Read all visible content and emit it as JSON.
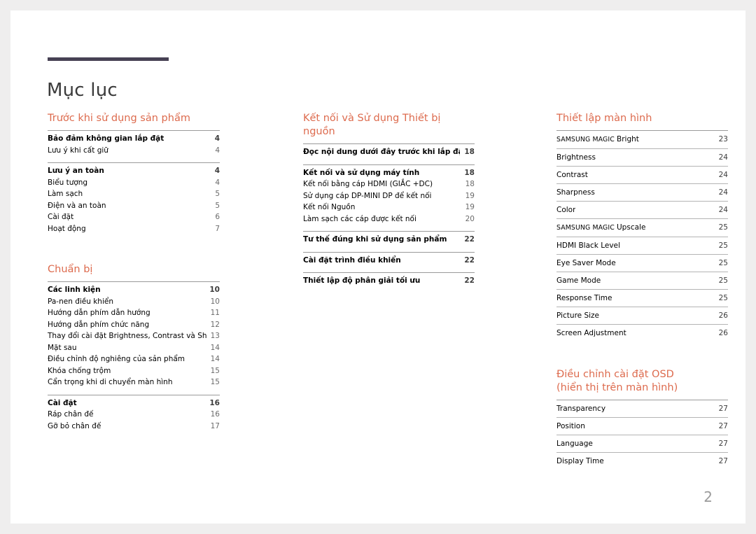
{
  "document": {
    "title": "Mục lục",
    "folio": "2",
    "accent_color": "#dd6b4e",
    "rule_color": "#474154"
  },
  "columns": [
    {
      "id": "column-1",
      "sections": [
        {
          "heading": "Trước khi sử dụng sản phẩm",
          "groups": [
            {
              "entries": [
                {
                  "title": "Bảo đảm không gian lắp đặt",
                  "page": "4",
                  "lead": true
                },
                {
                  "title": "Lưu ý khi cất giữ",
                  "page": "4",
                  "lead": false
                }
              ]
            },
            {
              "entries": [
                {
                  "title": "Lưu ý an toàn",
                  "page": "4",
                  "lead": true
                },
                {
                  "title": "Biểu tượng",
                  "page": "4",
                  "lead": false
                },
                {
                  "title": "Làm sạch",
                  "page": "5",
                  "lead": false
                },
                {
                  "title": "Điện và an toàn",
                  "page": "5",
                  "lead": false
                },
                {
                  "title": "Cài đặt",
                  "page": "6",
                  "lead": false
                },
                {
                  "title": "Hoạt động",
                  "page": "7",
                  "lead": false
                }
              ]
            }
          ]
        },
        {
          "heading": "Chuẩn bị",
          "groups": [
            {
              "entries": [
                {
                  "title": "Các linh kiện",
                  "page": "10",
                  "lead": true
                },
                {
                  "title": "Pa-nen điều khiển",
                  "page": "10",
                  "lead": false
                },
                {
                  "title": "Hướng dẫn phím dẫn hướng",
                  "page": "11",
                  "lead": false
                },
                {
                  "title": "Hướng dẫn phím chức năng",
                  "page": "12",
                  "lead": false
                },
                {
                  "title": "Thay đổi cài đặt Brightness, Contrast và Sharpness",
                  "page": "13",
                  "lead": false
                },
                {
                  "title": "Mặt sau",
                  "page": "14",
                  "lead": false
                },
                {
                  "title": "Điều chỉnh độ nghiêng của sản phẩm",
                  "page": "14",
                  "lead": false
                },
                {
                  "title": "Khóa chống trộm",
                  "page": "15",
                  "lead": false
                },
                {
                  "title": "Cẩn trọng khi di chuyển màn hình",
                  "page": "15",
                  "lead": false
                }
              ]
            },
            {
              "entries": [
                {
                  "title": "Cài đặt",
                  "page": "16",
                  "lead": true
                },
                {
                  "title": "Ráp chân đế",
                  "page": "16",
                  "lead": false
                },
                {
                  "title": "Gỡ bỏ chân đế",
                  "page": "17",
                  "lead": false
                }
              ]
            }
          ]
        }
      ]
    },
    {
      "id": "column-2",
      "sections": [
        {
          "heading": "Kết nối và Sử dụng Thiết bị nguồn",
          "groups": [
            {
              "entries": [
                {
                  "title": "Đọc nội dung dưới đây trước khi lắp đặt màn hình.",
                  "page": "18",
                  "lead": true
                }
              ]
            },
            {
              "entries": [
                {
                  "title": "Kết nối và sử dụng máy tính",
                  "page": "18",
                  "lead": true
                },
                {
                  "title": "Kết nối bằng cáp HDMI (GIẮC +DC)",
                  "page": "18",
                  "lead": false
                },
                {
                  "title": "Sử dụng cáp DP-MINI DP để kết nối",
                  "page": "19",
                  "lead": false
                },
                {
                  "title": "Kết nối Nguồn",
                  "page": "19",
                  "lead": false
                },
                {
                  "title": "Làm sạch các cáp được kết nối",
                  "page": "20",
                  "lead": false
                }
              ]
            },
            {
              "entries": [
                {
                  "title": "Tư thế đúng khi sử dụng sản phẩm",
                  "page": "22",
                  "lead": true
                }
              ]
            },
            {
              "entries": [
                {
                  "title": "Cài đặt trình điều khiển",
                  "page": "22",
                  "lead": true
                }
              ]
            },
            {
              "entries": [
                {
                  "title": "Thiết lập độ phân giải tối ưu",
                  "page": "22",
                  "lead": true
                }
              ]
            }
          ]
        }
      ]
    },
    {
      "id": "column-3",
      "sections": [
        {
          "heading": "Thiết lập màn hình",
          "ruled": true,
          "groups": [
            {
              "entries": [
                {
                  "title": "SAMSUNG MAGIC Bright",
                  "smallcaps": "SAMSUNG MAGIC",
                  "rest": "Bright",
                  "page": "23",
                  "lead": false
                },
                {
                  "title": "Brightness",
                  "page": "24",
                  "lead": false
                },
                {
                  "title": "Contrast",
                  "page": "24",
                  "lead": false
                },
                {
                  "title": "Sharpness",
                  "page": "24",
                  "lead": false
                },
                {
                  "title": "Color",
                  "page": "24",
                  "lead": false
                },
                {
                  "title": "SAMSUNG MAGIC Upscale",
                  "smallcaps": "SAMSUNG MAGIC",
                  "rest": "Upscale",
                  "page": "25",
                  "lead": false
                },
                {
                  "title": "HDMI Black Level",
                  "page": "25",
                  "lead": false
                },
                {
                  "title": "Eye Saver Mode",
                  "page": "25",
                  "lead": false
                },
                {
                  "title": "Game Mode",
                  "page": "25",
                  "lead": false
                },
                {
                  "title": "Response Time",
                  "page": "25",
                  "lead": false
                },
                {
                  "title": "Picture Size",
                  "page": "26",
                  "lead": false
                },
                {
                  "title": "Screen Adjustment",
                  "page": "26",
                  "lead": false
                }
              ]
            }
          ]
        },
        {
          "heading": "Điều chỉnh cài đặt OSD\n(hiển thị trên màn hình)",
          "ruled": true,
          "groups": [
            {
              "entries": [
                {
                  "title": "Transparency",
                  "page": "27",
                  "lead": false
                },
                {
                  "title": "Position",
                  "page": "27",
                  "lead": false
                },
                {
                  "title": "Language",
                  "page": "27",
                  "lead": false
                },
                {
                  "title": "Display Time",
                  "page": "27",
                  "lead": false
                }
              ]
            }
          ]
        }
      ]
    }
  ]
}
